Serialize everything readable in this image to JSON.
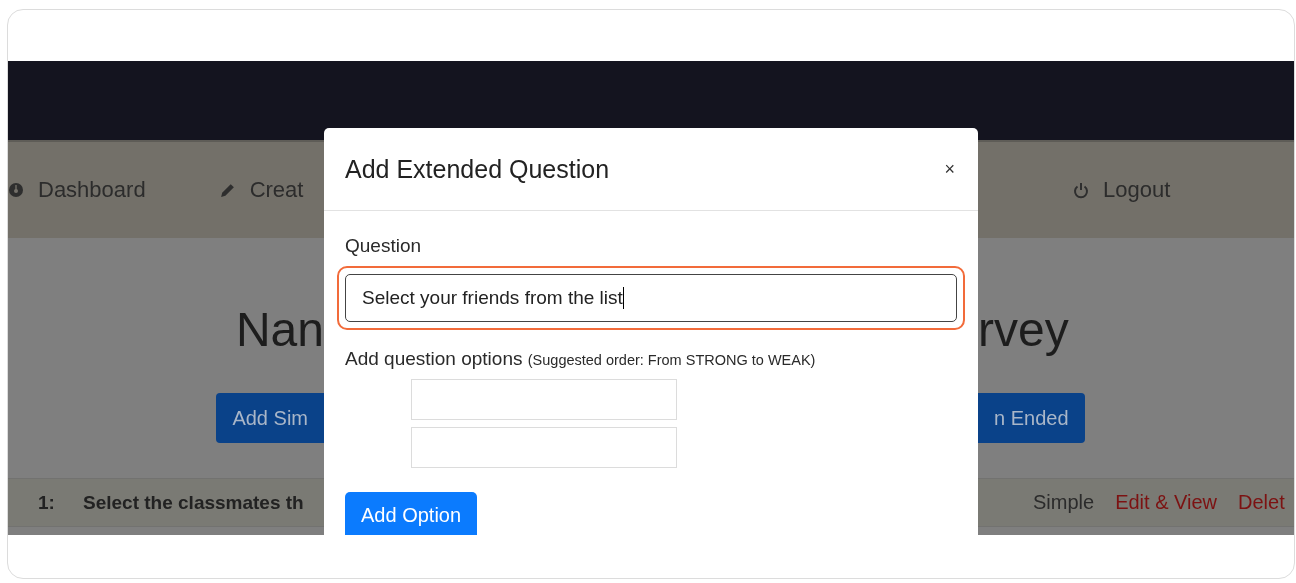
{
  "nav": {
    "left": [
      {
        "label": "Dashboard"
      },
      {
        "label": "Creat"
      }
    ],
    "right": [
      {
        "label": "Logout"
      }
    ]
  },
  "heading": {
    "left": "Nan",
    "right": "rvey"
  },
  "buttons": {
    "left": "Add Sim",
    "right": "n Ended"
  },
  "question_row": {
    "number": "1:",
    "text": "Select the classmates th",
    "type": "Simple",
    "links": [
      "Edit & View",
      "Delet"
    ]
  },
  "modal": {
    "title": "Add Extended Question",
    "close": "×",
    "question_label": "Question",
    "question_value": "Select your friends from the list",
    "focused": true,
    "options_label": "Add question options",
    "options_hint": "(Suggested order: From STRONG to WEAK)",
    "option_fields": [
      {
        "kind": "text"
      },
      {
        "kind": "text"
      }
    ],
    "add_button": "Add Option"
  }
}
